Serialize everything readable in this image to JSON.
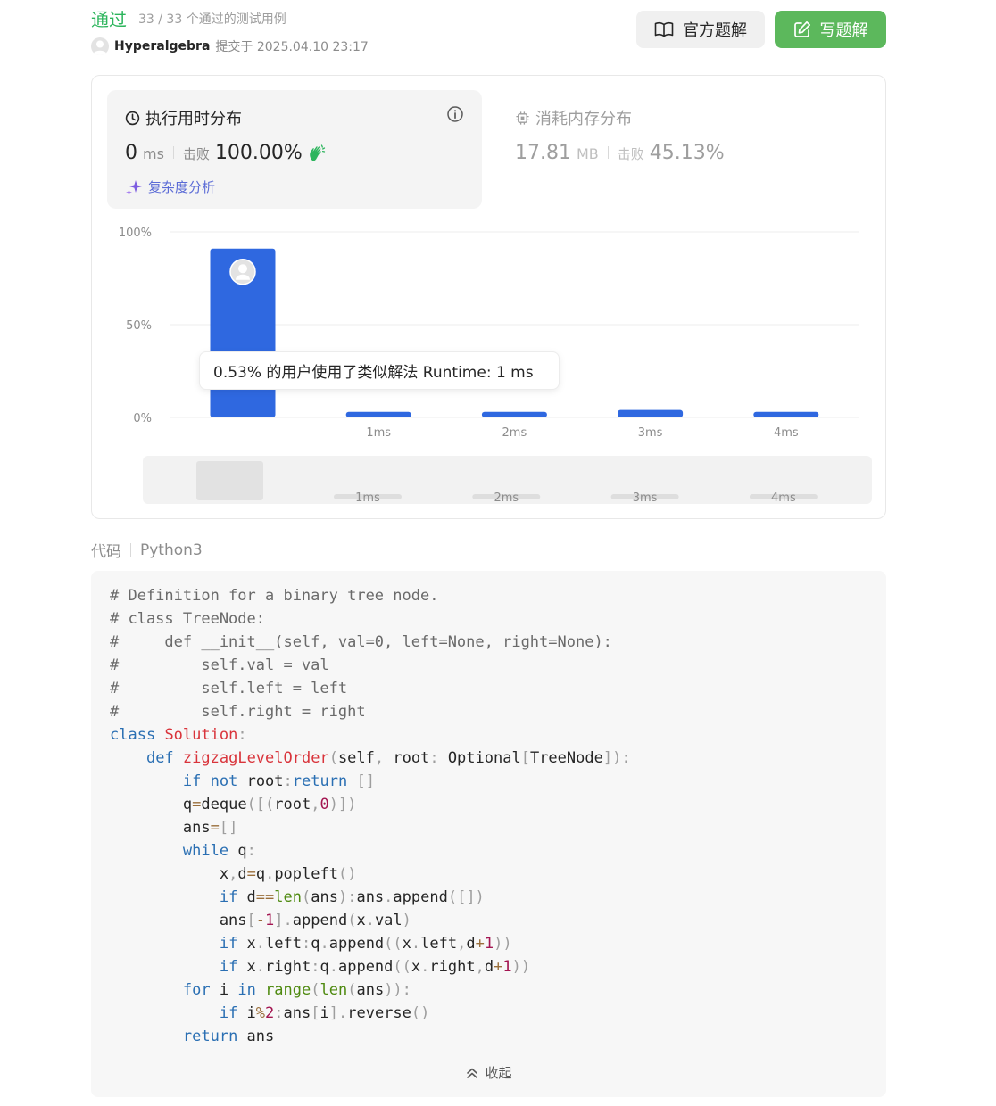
{
  "header": {
    "status": "通过",
    "passed_text": "33 / 33 个通过的测试用例",
    "username": "Hyperalgebra",
    "submitted_text": "提交于 2025.04.10 23:17",
    "official_solution_label": "官方题解",
    "write_solution_label": "写题解"
  },
  "runtime": {
    "title": "执行用时分布",
    "value": "0",
    "unit": "ms",
    "beat_label": "击败",
    "beat_value": "100.00%",
    "analysis_label": "复杂度分析"
  },
  "memory": {
    "title": "消耗内存分布",
    "value": "17.81",
    "unit": "MB",
    "beat_label": "击败",
    "beat_value": "45.13%"
  },
  "chart_data": {
    "type": "bar",
    "categories": [
      "",
      "1ms",
      "2ms",
      "3ms",
      "4ms"
    ],
    "values": [
      91,
      3,
      3,
      4,
      3
    ],
    "y_ticks": [
      "0%",
      "50%",
      "100%"
    ],
    "ylim": [
      0,
      100
    ],
    "grid": true,
    "bar_color": "#2f68e0"
  },
  "brush": {
    "labels": [
      "1ms",
      "2ms",
      "3ms",
      "4ms"
    ]
  },
  "tooltip": {
    "text": "0.53% 的用户使用了类似解法 Runtime: 1 ms"
  },
  "code": {
    "label": "代码",
    "language": "Python3",
    "collapse_label": "收起"
  },
  "colors": {
    "accept_green": "#2db55d",
    "primary_button": "#5cb85c",
    "bar_blue": "#2f68e0"
  }
}
